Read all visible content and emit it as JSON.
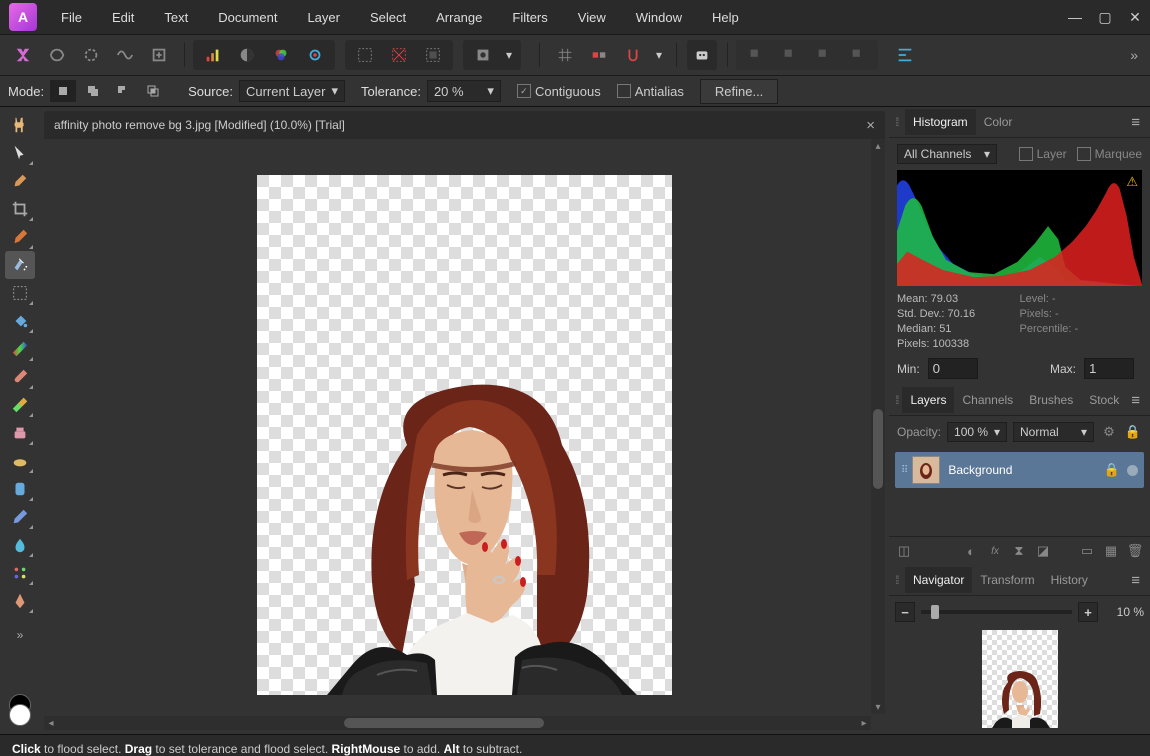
{
  "menu": [
    "File",
    "Edit",
    "Text",
    "Document",
    "Layer",
    "Select",
    "Arrange",
    "Filters",
    "View",
    "Window",
    "Help"
  ],
  "context": {
    "mode_label": "Mode:",
    "source_label": "Source:",
    "source_value": "Current Layer",
    "tolerance_label": "Tolerance:",
    "tolerance_value": "20 %",
    "contiguous": "Contiguous",
    "antialias": "Antialias",
    "refine": "Refine..."
  },
  "doc_title": "affinity photo remove bg 3.jpg [Modified] (10.0%) [Trial]",
  "hist": {
    "tab1": "Histogram",
    "tab2": "Color",
    "channels": "All Channels",
    "layer": "Layer",
    "marquee": "Marquee",
    "mean": "Mean: 79.03",
    "stddev": "Std. Dev.: 70.16",
    "median": "Median: 51",
    "pixels": "Pixels: 100338",
    "level": "Level: -",
    "pixels2": "Pixels: -",
    "percentile": "Percentile: -",
    "min_label": "Min:",
    "min_val": "0",
    "max_label": "Max:",
    "max_val": "1"
  },
  "layers": {
    "tab1": "Layers",
    "tab2": "Channels",
    "tab3": "Brushes",
    "tab4": "Stock",
    "opacity_label": "Opacity:",
    "opacity_val": "100 %",
    "blend": "Normal",
    "layer_name": "Background"
  },
  "nav": {
    "tab1": "Navigator",
    "tab2": "Transform",
    "tab3": "History",
    "zoom_val": "10 %"
  },
  "status": {
    "s1": "Click",
    "t1": " to flood select. ",
    "s2": "Drag",
    "t2": " to set tolerance and flood select. ",
    "s3": "RightMouse",
    "t3": " to add. ",
    "s4": "Alt",
    "t4": " to subtract."
  }
}
